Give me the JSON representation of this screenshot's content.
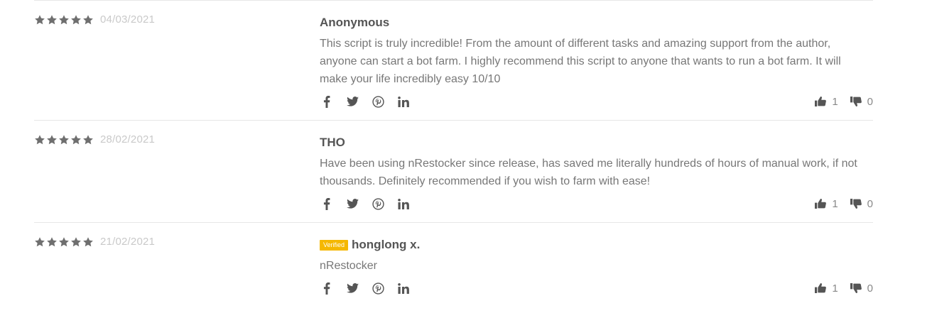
{
  "reviews": [
    {
      "rating": 5,
      "date": "04/03/2021",
      "author": "Anonymous",
      "verified": false,
      "text": "This script is truly incredible! From the amount of different tasks and amazing support from the author, anyone can start a bot farm. I highly recommend this script to anyone that wants to run a bot farm. It will make your life incredibly easy 10/10",
      "likes": "1",
      "dislikes": "0"
    },
    {
      "rating": 5,
      "date": "28/02/2021",
      "author": "THO",
      "verified": false,
      "text": "Have been using nRestocker since release, has saved me literally hundreds of hours of manual work, if not thousands. Definitely recommended if you wish to farm with ease!",
      "likes": "1",
      "dislikes": "0"
    },
    {
      "rating": 5,
      "date": "21/02/2021",
      "author": "honglong x.",
      "verified": true,
      "verified_label": "Verified",
      "text": "nRestocker",
      "likes": "1",
      "dislikes": "0"
    }
  ],
  "share_icons": [
    "facebook-icon",
    "twitter-icon",
    "pinterest-icon",
    "linkedin-icon"
  ],
  "colors": {
    "star": "#6f6f6f",
    "badge": "#f5b800",
    "icon": "#555555",
    "date": "#c9c9c9"
  }
}
